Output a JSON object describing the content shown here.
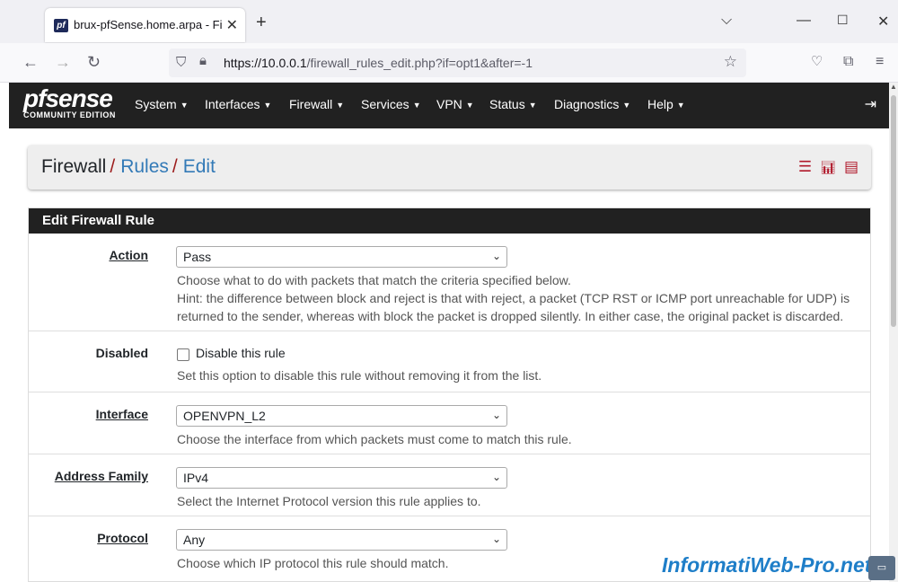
{
  "browser": {
    "tab_title": "brux-pfSense.home.arpa - Firew",
    "tab_favicon": "pf",
    "url_host": "https://10.0.0.1",
    "url_path": "/firewall_rules_edit.php?if=opt1&after=-1"
  },
  "logo": {
    "brand": "sense",
    "brand_prefix": "pf",
    "edition": "COMMUNITY EDITION"
  },
  "menu": [
    "System",
    "Interfaces",
    "Firewall",
    "Services",
    "VPN",
    "Status",
    "Diagnostics",
    "Help"
  ],
  "breadcrumb": {
    "root": "Firewall",
    "sep": "/",
    "level1": "Rules",
    "level2": "Edit"
  },
  "panel": {
    "title": "Edit Firewall Rule",
    "action": {
      "label": "Action",
      "value": "Pass",
      "help1": "Choose what to do with packets that match the criteria specified below.",
      "help2": "Hint: the difference between block and reject is that with reject, a packet (TCP RST or ICMP port unreachable for UDP) is",
      "help3": "returned to the sender, whereas with block the packet is dropped silently. In either case, the original packet is discarded."
    },
    "disabled": {
      "label": "Disabled",
      "checkbox_label": "Disable this rule",
      "checked": false,
      "help": "Set this option to disable this rule without removing it from the list."
    },
    "interface": {
      "label": "Interface",
      "value": "OPENVPN_L2",
      "help": "Choose the interface from which packets must come to match this rule."
    },
    "address_family": {
      "label": "Address Family",
      "value": "IPv4",
      "help": "Select the Internet Protocol version this rule applies to."
    },
    "protocol": {
      "label": "Protocol",
      "value": "Any",
      "help": "Choose which IP protocol this rule should match."
    }
  },
  "watermark": "InformatiWeb-Pro.net",
  "colors": {
    "nav_bg": "#212121",
    "accent_red": "#b0182a",
    "link": "#337ab7"
  }
}
